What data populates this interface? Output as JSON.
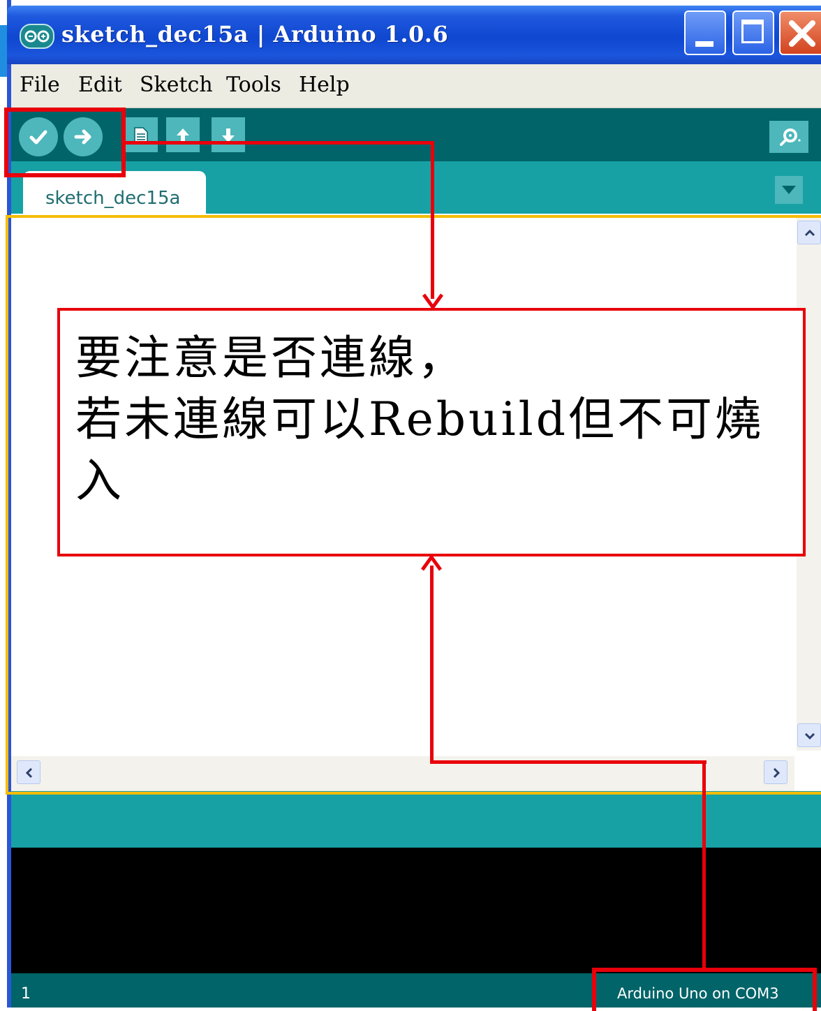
{
  "window": {
    "title": "sketch_dec15a | Arduino 1.0.6"
  },
  "menu": [
    {
      "label": "File"
    },
    {
      "label": "Edit"
    },
    {
      "label": "Sketch"
    },
    {
      "label": "Tools"
    },
    {
      "label": "Help"
    }
  ],
  "toolbar": {
    "icons": [
      "verify-icon",
      "upload-icon",
      "new-icon",
      "open-icon",
      "save-icon",
      "serial-monitor-icon"
    ]
  },
  "tab": {
    "label": "sketch_dec15a"
  },
  "status": {
    "line_number": "1",
    "board": "Arduino Uno on COM3"
  },
  "annotation": {
    "text": "要注意是否連線，\n若未連線可以Rebuild但不可燒\n入"
  },
  "colors": {
    "toolbar": "#006468",
    "tab_strip": "#17a1a5",
    "icon_fill": "#4db7bb",
    "annotation_red": "#e8000b",
    "editor_outline": "#f5bc00"
  }
}
